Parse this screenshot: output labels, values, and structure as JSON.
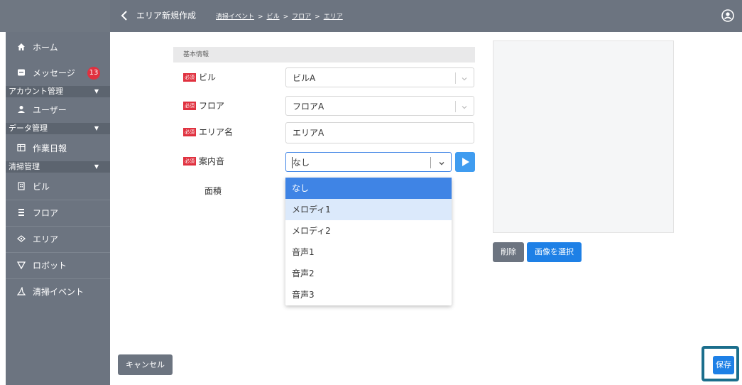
{
  "header": {
    "title": "エリア新規作成",
    "breadcrumb": [
      "清掃イベント",
      "ビル",
      "フロア",
      "エリア"
    ],
    "breadcrumb_separator": ">"
  },
  "sidebar": {
    "items": [
      {
        "label": "ホーム",
        "icon": "home-icon"
      },
      {
        "label": "メッセージ",
        "icon": "message-icon",
        "badge": "13"
      },
      {
        "label": "ユーザー",
        "icon": "user-icon"
      },
      {
        "label": "作業日報",
        "icon": "report-icon"
      },
      {
        "label": "ビル",
        "icon": "building-icon"
      },
      {
        "label": "フロア",
        "icon": "floor-icon"
      },
      {
        "label": "エリア",
        "icon": "area-icon"
      },
      {
        "label": "ロボット",
        "icon": "robot-icon"
      },
      {
        "label": "清掃イベント",
        "icon": "cleaning-event-icon"
      }
    ],
    "groups": [
      "アカウント管理",
      "データ管理",
      "清掃管理"
    ]
  },
  "form": {
    "section_title": "基本情報",
    "required_tag": "必須",
    "building": {
      "label": "ビル",
      "value": "ビルA"
    },
    "floor": {
      "label": "フロア",
      "value": "フロアA"
    },
    "area_name": {
      "label": "エリア名",
      "value": "エリアA"
    },
    "guidance_sound": {
      "label": "案内音",
      "value": "なし",
      "options": [
        "なし",
        "メロディ1",
        "メロディ2",
        "音声1",
        "音声2",
        "音声3"
      ],
      "selected_index": 0,
      "hovered_index": 1
    },
    "area_size": {
      "label": "面積"
    }
  },
  "image": {
    "delete_label": "削除",
    "select_label": "画像を選択"
  },
  "footer": {
    "cancel_label": "キャンセル",
    "save_label": "保存"
  },
  "colors": {
    "sidebar_bg": "#6c7480",
    "primary": "#1e80e6",
    "required": "#e0313f",
    "highlight_border": "#1b6e8c"
  }
}
